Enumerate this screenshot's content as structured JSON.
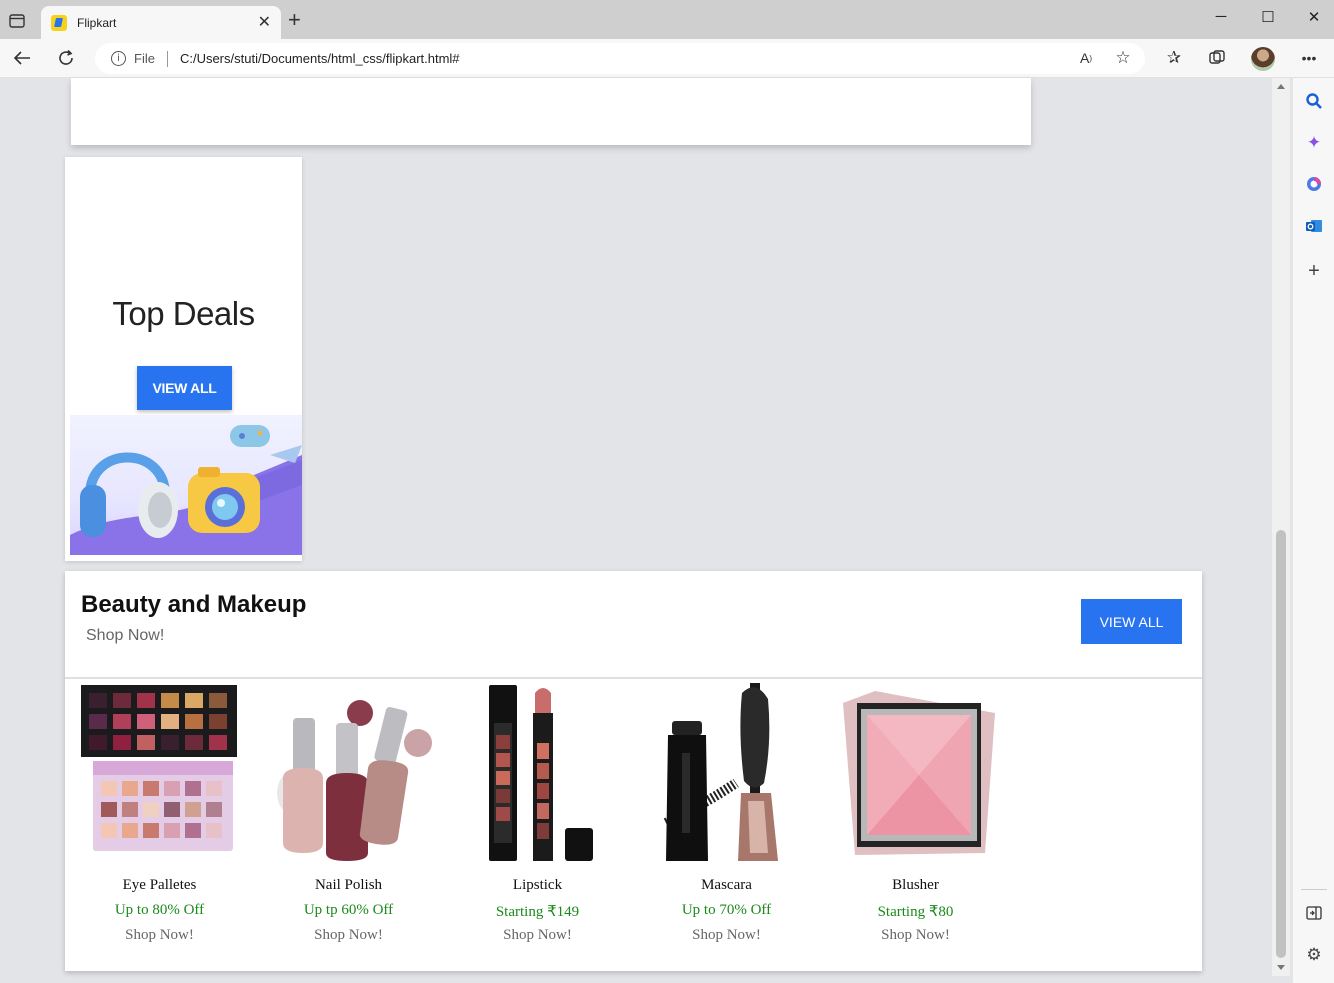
{
  "browser": {
    "tab_title": "Flipkart",
    "file_label": "File",
    "url": "C:/Users/stuti/Documents/html_css/flipkart.html#"
  },
  "top_deals": {
    "title": "Top Deals",
    "button_label": "VIEW ALL"
  },
  "beauty": {
    "title": "Beauty and Makeup",
    "subtitle": "Shop Now!",
    "button_label": "VIEW ALL",
    "products": [
      {
        "name": "Eye Palletes",
        "offer": "Up to 80% Off",
        "cta": "Shop Now!"
      },
      {
        "name": "Nail Polish",
        "offer": "Up tp 60% Off",
        "cta": "Shop Now!"
      },
      {
        "name": "Lipstick",
        "offer": "Starting ₹149",
        "cta": "Shop Now!"
      },
      {
        "name": "Mascara",
        "offer": "Up to 70% Off",
        "cta": "Shop Now!"
      },
      {
        "name": "Blusher",
        "offer": "Starting ₹80",
        "cta": "Shop Now!"
      }
    ]
  },
  "colors": {
    "brand_blue": "#2874f0",
    "offer_green": "#1a8a1a",
    "page_bg": "#e3e4e8"
  }
}
